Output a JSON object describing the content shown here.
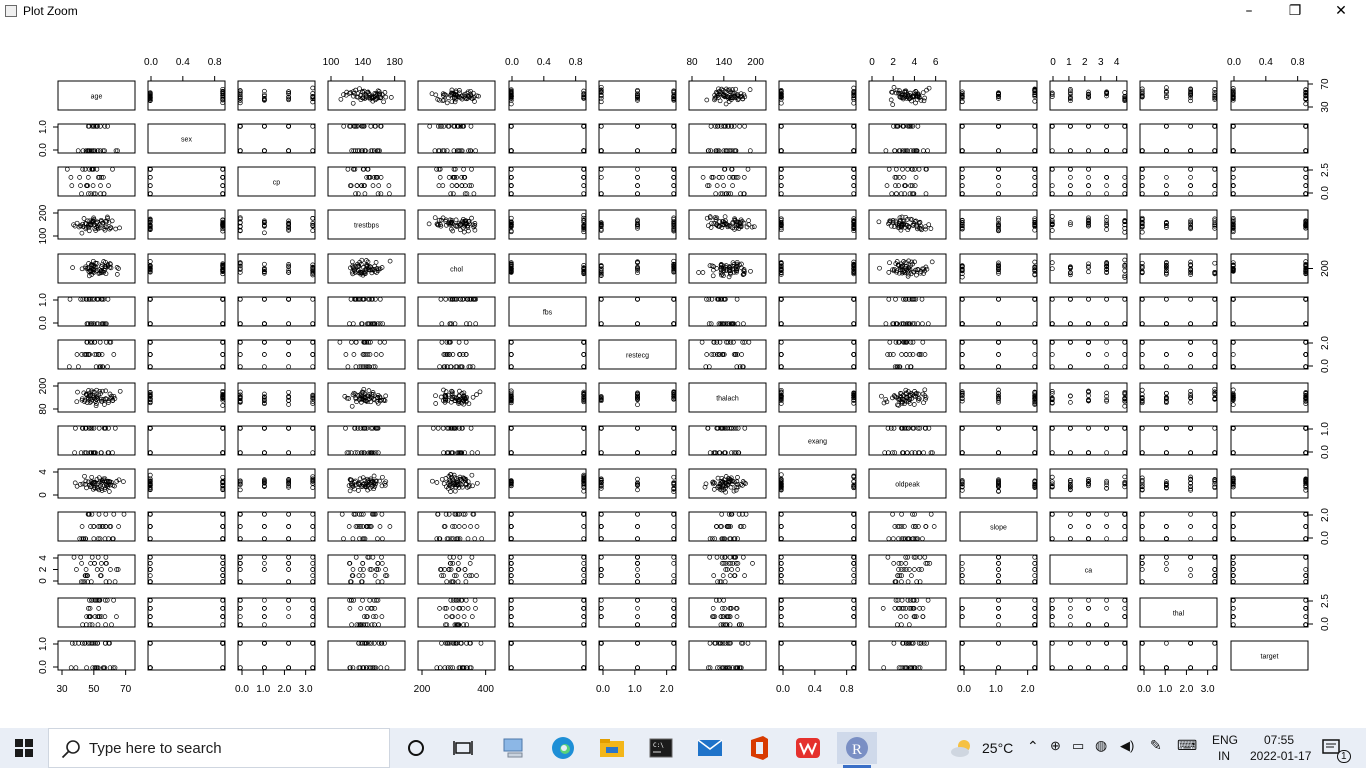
{
  "window": {
    "title": "Plot Zoom",
    "controls": {
      "minimize": "–",
      "maximize": "❐",
      "close": "✕"
    }
  },
  "chart_data": {
    "type": "scatter",
    "variables": [
      "age",
      "sex",
      "cp",
      "trestbps",
      "chol",
      "fbs",
      "restecg",
      "thalach",
      "exang",
      "oldpeak",
      "slope",
      "ca",
      "thal",
      "target"
    ],
    "axis_ticks": {
      "top": [
        {
          "col": 1,
          "ticks": [
            "0.0",
            "0.4",
            "0.8"
          ]
        },
        {
          "col": 3,
          "ticks": [
            "100",
            "140",
            "180"
          ]
        },
        {
          "col": 5,
          "ticks": [
            "0.0",
            "0.4",
            "0.8"
          ]
        },
        {
          "col": 7,
          "ticks": [
            "80",
            "140",
            "200"
          ]
        },
        {
          "col": 9,
          "ticks": [
            "0",
            "2",
            "4",
            "6"
          ]
        },
        {
          "col": 11,
          "ticks": [
            "0",
            "1",
            "2",
            "3",
            "4"
          ]
        },
        {
          "col": 13,
          "ticks": [
            "0.0",
            "0.4",
            "0.8"
          ]
        }
      ],
      "bottom": [
        {
          "col": 0,
          "ticks": [
            "30",
            "50",
            "70"
          ]
        },
        {
          "col": 2,
          "ticks": [
            "0.0",
            "1.0",
            "2.0",
            "3.0"
          ]
        },
        {
          "col": 4,
          "ticks": [
            "200",
            "400"
          ]
        },
        {
          "col": 6,
          "ticks": [
            "0.0",
            "1.0",
            "2.0"
          ]
        },
        {
          "col": 8,
          "ticks": [
            "0.0",
            "0.4",
            "0.8"
          ]
        },
        {
          "col": 10,
          "ticks": [
            "0.0",
            "1.0",
            "2.0"
          ]
        },
        {
          "col": 12,
          "ticks": [
            "0.0",
            "1.0",
            "2.0",
            "3.0"
          ]
        }
      ],
      "left": [
        {
          "row": 1,
          "ticks": [
            "0.0",
            "1.0"
          ]
        },
        {
          "row": 3,
          "ticks": [
            "100",
            "200"
          ]
        },
        {
          "row": 5,
          "ticks": [
            "0.0",
            "1.0"
          ]
        },
        {
          "row": 7,
          "ticks": [
            "80",
            "200"
          ]
        },
        {
          "row": 9,
          "ticks": [
            "0",
            "4"
          ]
        },
        {
          "row": 11,
          "ticks": [
            "0",
            "2",
            "4"
          ]
        },
        {
          "row": 13,
          "ticks": [
            "0.0",
            "1.0"
          ]
        }
      ],
      "right": [
        {
          "row": 0,
          "ticks": [
            "30",
            "70"
          ]
        },
        {
          "row": 2,
          "ticks": [
            "0.0",
            "2.5"
          ]
        },
        {
          "row": 4,
          "ticks": [
            "200"
          ]
        },
        {
          "row": 6,
          "ticks": [
            "0.0",
            "2.0"
          ]
        },
        {
          "row": 8,
          "ticks": [
            "0.0",
            "1.0"
          ]
        },
        {
          "row": 10,
          "ticks": [
            "0.0",
            "2.0"
          ]
        },
        {
          "row": 12,
          "ticks": [
            "0.0",
            "2.5"
          ]
        }
      ]
    }
  },
  "taskbar": {
    "search_placeholder": "Type here to search",
    "weather_temp": "25°C",
    "language_line1": "ENG",
    "language_line2": "IN",
    "time": "07:55",
    "date": "2022-01-17",
    "notification_count": "1",
    "colors": {
      "edge": "#1e8fd6",
      "files": "#f3b61a",
      "mail": "#1f73c9",
      "office": "#d83b01",
      "wps": "#e5312d",
      "r": "#7a8fc4"
    }
  }
}
